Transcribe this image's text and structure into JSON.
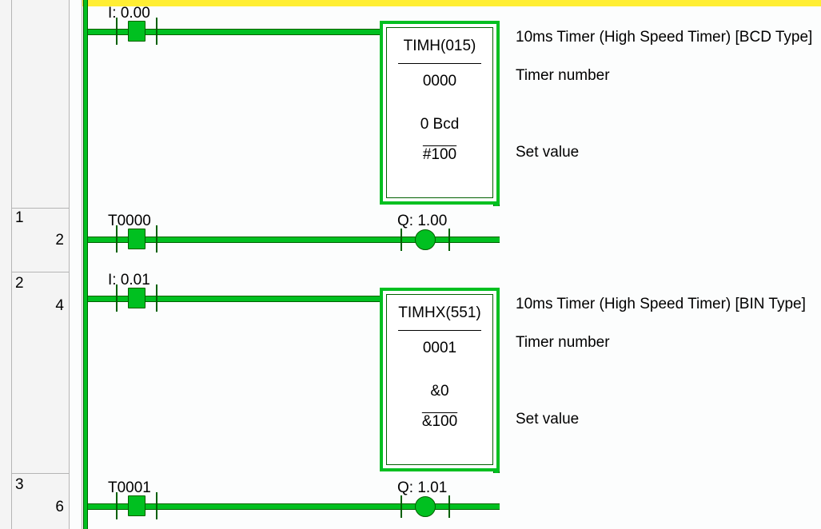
{
  "gutter": {
    "rows": [
      {
        "rung": "1",
        "step": "2"
      },
      {
        "rung": "2",
        "step": "4"
      },
      {
        "rung": "3",
        "step": "6"
      }
    ]
  },
  "rungs": [
    {
      "contact_label": "I: 0.00",
      "block": {
        "title": "TIMH(015)",
        "p1": "0000",
        "p2a": "0 Bcd",
        "p2b": "#100"
      },
      "comments": {
        "c1": "10ms Timer (High Speed Timer) [BCD Type]",
        "c2": "Timer number",
        "c3": "Set value"
      }
    },
    {
      "contact_label": "T0000",
      "coil_label": "Q: 1.00"
    },
    {
      "contact_label": "I: 0.01",
      "block": {
        "title": "TIMHX(551)",
        "p1": "0001",
        "p2a": "&0",
        "p2b": "&100"
      },
      "comments": {
        "c1": "10ms Timer (High Speed Timer) [BIN Type]",
        "c2": "Timer number",
        "c3": "Set value"
      }
    },
    {
      "contact_label": "T0001",
      "coil_label": "Q: 1.01"
    }
  ]
}
